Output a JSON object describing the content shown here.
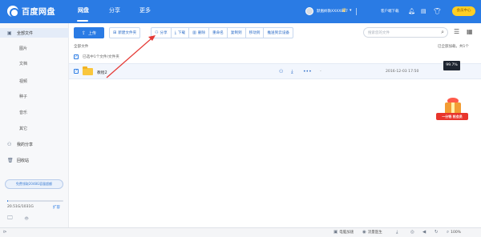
{
  "app": {
    "logo_text": "百度网盘",
    "nav_tabs": [
      "网盘",
      "分享",
      "更多"
    ],
    "username": "默凰蛉轶XXXX887",
    "client_download": "客户端下载",
    "vip_label": "会员中心"
  },
  "sidebar": {
    "items": [
      {
        "label": "全部文件",
        "icon": "folder-icon"
      },
      {
        "label": "图片"
      },
      {
        "label": "文档"
      },
      {
        "label": "视频"
      },
      {
        "label": "种子"
      },
      {
        "label": "音乐"
      },
      {
        "label": "其它"
      },
      {
        "label": "我的分享",
        "icon": "share-icon"
      },
      {
        "label": "回收站",
        "icon": "trash-icon"
      }
    ],
    "promo": "免费领取2048G容量超额",
    "storage_text": "20.51G/1031G",
    "storage_fraction": 0.02,
    "expand_label": "扩容"
  },
  "toolbar": {
    "upload": "上传",
    "new_folder": "新建文件夹",
    "share": "分享",
    "download": "下载",
    "delete": "删除",
    "rename": "重命名",
    "copy_to": "复制到",
    "move_to": "移动到",
    "push_to_device": "推送到云设备",
    "search_placeholder": "搜索您的文件"
  },
  "breadcrumb": "全部文件",
  "loaded_info": "已全部加载，共1个",
  "selection_text": "已选中1个文件/文件夹",
  "files": [
    {
      "name": "教程2",
      "date": "2016-12-03 17:50",
      "size": "-"
    }
  ],
  "tooltip": "99.7%",
  "promo_gift": "一分钱 抢会员",
  "statusbar": {
    "pc_accelerate": "电脑加速",
    "traffic_doctor": "流量医生",
    "zoom": "100%"
  },
  "colors": {
    "accent": "#2a7be4",
    "vip": "#ffcf24",
    "annotation": "#e53935"
  }
}
